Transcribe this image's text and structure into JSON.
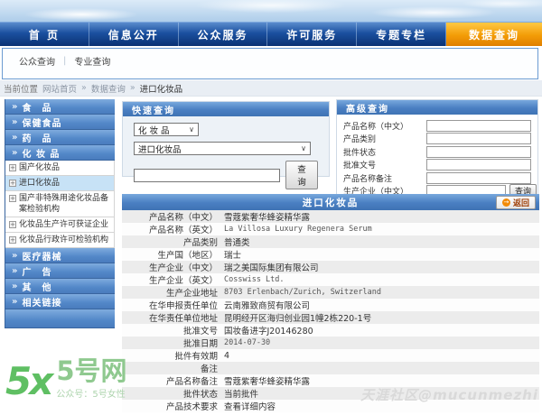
{
  "icons": {
    "double_arrow": "»",
    "chevron_down": "∨",
    "back_arrow": "→",
    "expand": "+"
  },
  "colors": {
    "nav_blue": "#1b509f",
    "active_orange": "#f39c07",
    "panel_header_blue": "#4a7fc2",
    "sidebar_blue": "#5287c8",
    "active_item_bg": "#c7e2f6",
    "logo_green": "#5fbf63",
    "watermark_gray": "#d9d9d9"
  },
  "nav": {
    "items": [
      {
        "label": "首  页",
        "active": false
      },
      {
        "label": "信息公开",
        "active": false
      },
      {
        "label": "公众服务",
        "active": false
      },
      {
        "label": "许可服务",
        "active": false
      },
      {
        "label": "专题专栏",
        "active": false
      },
      {
        "label": "数据查询",
        "active": true
      }
    ]
  },
  "subnav": {
    "separator": "|",
    "items": [
      "公众查询",
      "专业查询"
    ]
  },
  "breadcrumb": {
    "prefix": "当前位置",
    "separator": "»",
    "items": [
      "网站首页",
      "数据查询",
      "进口化妆品"
    ]
  },
  "sidebar": {
    "items": [
      {
        "type": "header",
        "label": "食　品"
      },
      {
        "type": "header",
        "label": "保健食品"
      },
      {
        "type": "header",
        "label": "药　品"
      },
      {
        "type": "header",
        "label": "化 妆 品"
      },
      {
        "type": "item",
        "label": "国产化妆品",
        "active": false
      },
      {
        "type": "item",
        "label": "进口化妆品",
        "active": true
      },
      {
        "type": "item",
        "label": "国产非特殊用途化妆品备案检验机构",
        "active": false
      },
      {
        "type": "item",
        "label": "化妆品生产许可获证企业",
        "active": false
      },
      {
        "type": "item",
        "label": "化妆品行政许可检验机构",
        "active": false
      },
      {
        "type": "header",
        "label": "医疗器械"
      },
      {
        "type": "header",
        "label": "广　告"
      },
      {
        "type": "header",
        "label": "其　他"
      },
      {
        "type": "header",
        "label": "相关链接"
      },
      {
        "type": "spacer",
        "label": ""
      }
    ]
  },
  "quick_search": {
    "title": "快速查询",
    "category_value": "化 妆 品",
    "type_value": "进口化妆品",
    "keyword_value": "",
    "button": "查询"
  },
  "advanced_search": {
    "title": "高级查询",
    "button": "查询",
    "fields": [
      {
        "label": "产品名称（中文）",
        "value": ""
      },
      {
        "label": "产品类别",
        "value": ""
      },
      {
        "label": "批件状态",
        "value": ""
      },
      {
        "label": "批准文号",
        "value": ""
      },
      {
        "label": "产品名称备注",
        "value": ""
      },
      {
        "label": "生产企业（中文）",
        "value": ""
      }
    ]
  },
  "detail": {
    "title": "进口化妆品",
    "back_button": "返回",
    "rows": [
      {
        "label": "产品名称（中文）",
        "value": "雪蔻紫奢华蜂姿精华露",
        "en": false,
        "link": false
      },
      {
        "label": "产品名称（英文）",
        "value": "La Villosa Luxury Regenera Serum",
        "en": true,
        "link": false
      },
      {
        "label": "产品类别",
        "value": "普通类",
        "en": false,
        "link": false
      },
      {
        "label": "生产国（地区）",
        "value": "瑞士",
        "en": false,
        "link": false
      },
      {
        "label": "生产企业（中文）",
        "value": "瑞之美国际集团有限公司",
        "en": false,
        "link": false
      },
      {
        "label": "生产企业（英文）",
        "value": "Cosswiss Ltd.",
        "en": true,
        "link": false
      },
      {
        "label": "生产企业地址",
        "value": "8703 Erlenbach/Zurich, Switzerland",
        "en": true,
        "link": false
      },
      {
        "label": "在华申报责任单位",
        "value": "云南雅致商贸有限公司",
        "en": false,
        "link": false
      },
      {
        "label": "在华责任单位地址",
        "value": "昆明经开区海归创业园1幢2栋220-1号",
        "en": false,
        "link": false
      },
      {
        "label": "批准文号",
        "value": "国妆备进字J20146280",
        "en": false,
        "link": false
      },
      {
        "label": "批准日期",
        "value": "2014-07-30",
        "en": true,
        "link": false
      },
      {
        "label": "批件有效期",
        "value": "4",
        "en": false,
        "link": false
      },
      {
        "label": "备注",
        "value": "",
        "en": false,
        "link": false
      },
      {
        "label": "产品名称备注",
        "value": "雪蔻紫奢华蜂姿精华露",
        "en": false,
        "link": false
      },
      {
        "label": "批件状态",
        "value": "当前批件",
        "en": false,
        "link": false
      },
      {
        "label": "产品技术要求",
        "value": "查看详细内容",
        "en": false,
        "link": true
      }
    ]
  },
  "footer": {
    "logo_mark": "5x",
    "logo_text": "5号网",
    "slogan": "公众号：5号女性",
    "watermark": "天涯社区@mucunmezhi"
  }
}
